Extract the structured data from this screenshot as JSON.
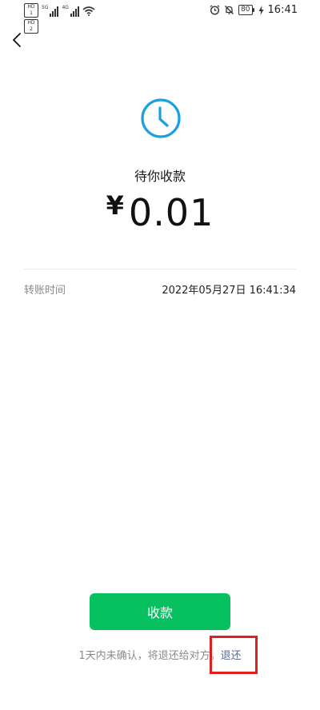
{
  "status_bar": {
    "sim1_badge": "HD 1",
    "sim2_badge": "HD 2",
    "signal1_tag": "5G",
    "signal2_tag": "4G",
    "battery_level": "80",
    "time": "16:41"
  },
  "transfer": {
    "status_title": "待你收款",
    "currency_symbol": "¥",
    "amount": "0.01",
    "time_label": "转账时间",
    "time_value": "2022年05月27日 16:41:34"
  },
  "actions": {
    "receive_label": "收款",
    "note_text": "1天内未确认，将退还给对方。",
    "refund_link": "退还"
  },
  "colors": {
    "accent_green": "#07c160",
    "clock_blue": "#1aa0e0",
    "link_blue": "#576b95",
    "highlight_red": "#e02020"
  }
}
